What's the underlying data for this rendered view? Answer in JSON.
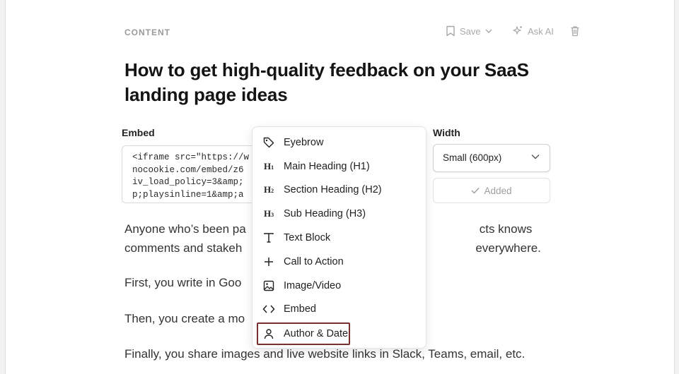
{
  "header": {
    "section_label": "CONTENT",
    "save_label": "Save",
    "ask_ai_label": "Ask AI"
  },
  "article": {
    "title": "How to get high-quality feedback on your SaaS landing page ideas"
  },
  "embed_block": {
    "embed_label": "Embed",
    "code": "<iframe src=\"https://w\nnocookie.com/embed/z6\niv_load_policy=3&amp;\np;playsinline=1&amp;a",
    "width_label": "Width",
    "width_value": "Small (600px)",
    "added_label": "Added"
  },
  "body": {
    "p1": "Anyone who’s been pa                                  cts knows comments and stakeh                                  everywhere.",
    "p2": "First, you write in Goo",
    "p3": "Then, you create a mo",
    "p4": "Finally, you share images and live website links in Slack, Teams, email, etc."
  },
  "block_menu": {
    "items": [
      {
        "label": "Eyebrow",
        "icon": "tag-icon"
      },
      {
        "label": "Main Heading (H1)",
        "icon": "h1-icon"
      },
      {
        "label": "Section Heading (H2)",
        "icon": "h2-icon"
      },
      {
        "label": "Sub Heading (H3)",
        "icon": "h3-icon"
      },
      {
        "label": "Text Block",
        "icon": "text-icon"
      },
      {
        "label": "Call to Action",
        "icon": "plus-icon"
      },
      {
        "label": "Image/Video",
        "icon": "image-icon"
      },
      {
        "label": "Embed",
        "icon": "code-icon"
      },
      {
        "label": "Author & Date",
        "icon": "user-icon"
      }
    ],
    "highlighted": "Author & Date"
  },
  "colors": {
    "highlight_border": "#7a2e2e",
    "muted": "#a8a8a8"
  }
}
